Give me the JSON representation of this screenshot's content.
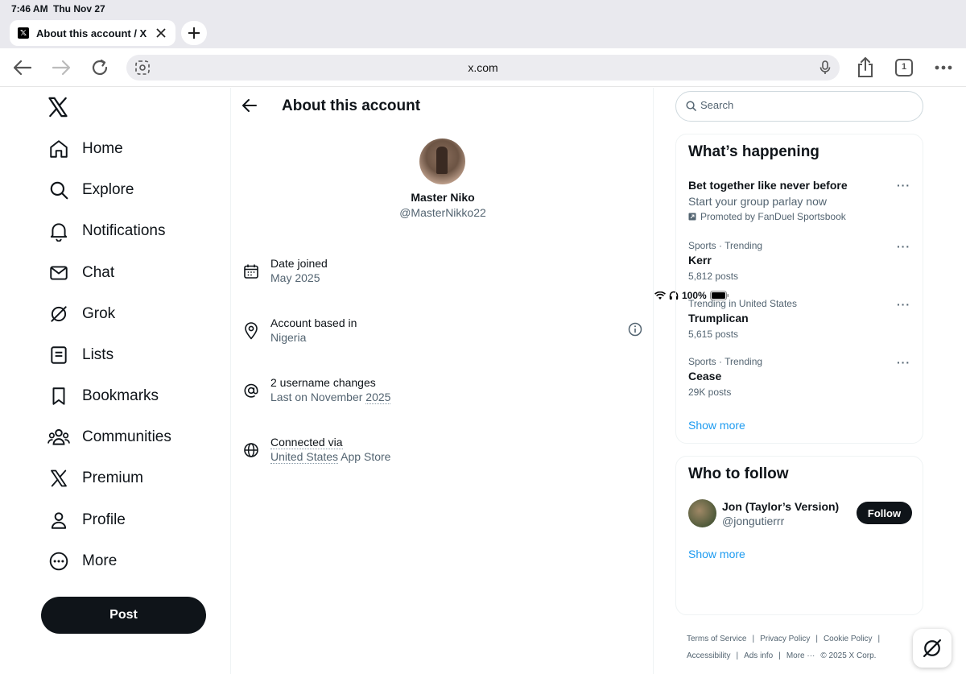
{
  "status_bar": {
    "time": "7:46 AM",
    "date": "Thu Nov 27",
    "battery": "100%"
  },
  "browser": {
    "tab_title": "About this account / X",
    "url": "x.com",
    "tab_count": "1"
  },
  "nav": {
    "items": [
      {
        "label": "Home",
        "icon": "home-icon"
      },
      {
        "label": "Explore",
        "icon": "search-icon"
      },
      {
        "label": "Notifications",
        "icon": "bell-icon"
      },
      {
        "label": "Chat",
        "icon": "mail-icon"
      },
      {
        "label": "Grok",
        "icon": "grok-icon"
      },
      {
        "label": "Lists",
        "icon": "list-icon"
      },
      {
        "label": "Bookmarks",
        "icon": "bookmark-icon"
      },
      {
        "label": "Communities",
        "icon": "communities-icon"
      },
      {
        "label": "Premium",
        "icon": "x-logo-icon"
      },
      {
        "label": "Profile",
        "icon": "person-icon"
      },
      {
        "label": "More",
        "icon": "more-circle-icon"
      }
    ],
    "post_label": "Post"
  },
  "main": {
    "title": "About this account",
    "profile": {
      "name": "Master Niko",
      "handle": "@MasterNikko22"
    },
    "rows": {
      "joined": {
        "title": "Date joined",
        "value": "May 2025"
      },
      "based": {
        "title": "Account based in",
        "value": "Nigeria"
      },
      "username": {
        "title": "2 username changes",
        "value_prefix": "Last on November ",
        "value_year": "2025"
      },
      "connected": {
        "title": "Connected via",
        "value_country": "United States",
        "value_suffix": " App Store"
      }
    }
  },
  "right": {
    "search_placeholder": "Search",
    "happening": {
      "title": "What’s happening",
      "promo": {
        "headline": "Bet together like never before",
        "subline": "Start your group parlay now",
        "promoted": "Promoted by FanDuel Sportsbook"
      },
      "trends": [
        {
          "meta": "Sports · Trending",
          "name": "Kerr",
          "count": "5,812 posts"
        },
        {
          "meta": "Trending in United States",
          "name": "Trumplican",
          "count": "5,615 posts"
        },
        {
          "meta": "Sports · Trending",
          "name": "Cease",
          "count": "29K posts"
        }
      ],
      "show_more": "Show more"
    },
    "who_to_follow": {
      "title": "Who to follow",
      "user": {
        "name": "Jon (Taylor’s Version)",
        "handle": "@jongutierrr"
      },
      "follow_label": "Follow",
      "show_more": "Show more"
    },
    "footer": {
      "terms": "Terms of Service",
      "privacy": "Privacy Policy",
      "cookie": "Cookie Policy",
      "accessibility": "Accessibility",
      "ads": "Ads info",
      "more": "More ···",
      "copyright": "© 2025 X Corp."
    }
  }
}
